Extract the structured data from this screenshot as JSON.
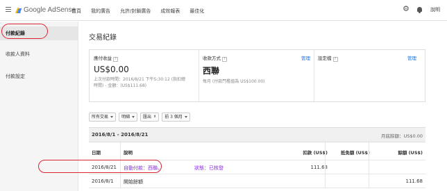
{
  "app": {
    "logo_text": "Google AdSense",
    "menu_icon": "hamburger-menu-icon"
  },
  "nav": {
    "items": [
      "首頁",
      "我的廣告",
      "允許/封鎖廣告",
      "成效報表",
      "最佳化"
    ]
  },
  "top_right": {
    "settings_icon": "gear-icon",
    "notifications_icon": "bell-icon",
    "help_label": "說明"
  },
  "sidebar": {
    "items": [
      {
        "label": "付款紀錄",
        "active": true
      },
      {
        "label": "收款人資料",
        "active": false
      },
      {
        "label": "付款設定",
        "active": false
      }
    ]
  },
  "main": {
    "title": "交易紀錄",
    "summary": {
      "earnings": {
        "label": "應付收益",
        "amount": "US$0.00",
        "detail_line1": "上次付款時間：2016/8/21 下午5:30:12 (指扣總",
        "detail_line2": "時間) - 金額：(US$111.68)"
      },
      "payment": {
        "label": "收款方式",
        "manage_label": "管理",
        "method": "西聯",
        "detail": "每月 (付款門檻值為 US$100.00)"
      },
      "settings": {
        "label": "設定檔",
        "manage_label": "管理"
      }
    },
    "filters": [
      {
        "label": "所有交易",
        "type": "dropdown"
      },
      {
        "label": "明細",
        "type": "dropdown"
      },
      {
        "label": "匯出",
        "type": "stepper"
      },
      {
        "label": "前 3 個月",
        "type": "dropdown"
      }
    ],
    "table": {
      "range_label": "2016/8/1 - 2016/8/21",
      "opening_balance_label": "月底餘額：US$0.00",
      "columns": {
        "date": "日期",
        "desc": "說明",
        "credit": "扣款 (US$)",
        "debit": "抵免額 (US$)",
        "balance": "餘額 (US$)"
      },
      "rows": [
        {
          "date": "2016/8/21",
          "desc_a": "自動付款：西聯。",
          "desc_b": "狀態：已核發",
          "credit": "111.68",
          "debit": "",
          "balance": ""
        },
        {
          "date": "2016/8/1",
          "desc_a": "開始餘額",
          "desc_b": "",
          "credit": "",
          "debit": "",
          "balance": "111.68"
        }
      ]
    }
  },
  "colors": {
    "accent_link": "#1a73e8",
    "annotation_red": "#dd2233",
    "link_purple": "#8a2be2"
  }
}
